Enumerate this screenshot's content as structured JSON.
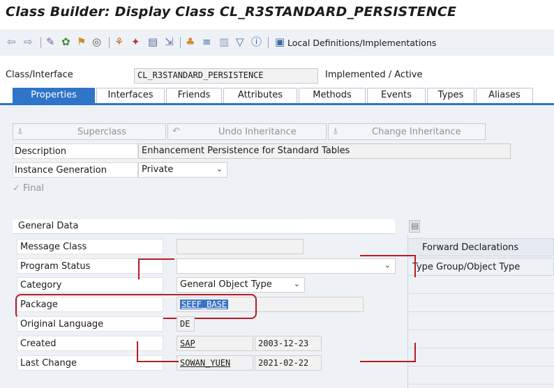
{
  "window": {
    "title": "Class Builder: Display Class CL_R3STANDARD_PERSISTENCE"
  },
  "toolbar": {
    "local_defs_label": "Local Definitions/Implementations"
  },
  "header": {
    "class_label": "Class/Interface",
    "class_value": "CL_R3STANDARD_PERSISTENCE",
    "status": "Implemented / Active"
  },
  "tabs": [
    "Properties",
    "Interfaces",
    "Friends",
    "Attributes",
    "Methods",
    "Events",
    "Types",
    "Aliases"
  ],
  "properties": {
    "superclass_btn": "Superclass",
    "undo_btn": "Undo Inheritance",
    "change_btn": "Change Inheritance",
    "description_label": "Description",
    "description_value": "Enhancement Persistence for Standard Tables",
    "instgen_label": "Instance Generation",
    "instgen_value": "Private",
    "final_label": "Final"
  },
  "general": {
    "title": "General Data",
    "message_class_label": "Message Class",
    "message_class_value": "",
    "program_status_label": "Program Status",
    "program_status_value": "",
    "category_label": "Category",
    "category_value": "General Object Type",
    "package_label": "Package",
    "package_value": "SEEF_BASE",
    "orig_lang_label": "Original Language",
    "orig_lang_value": "DE",
    "created_label": "Created",
    "created_user": "SAP",
    "created_date": "2003-12-23",
    "last_change_label": "Last Change",
    "last_change_user": "SOWAN_YUEN",
    "last_change_date": "2021-02-22"
  },
  "forward": {
    "title": "Forward Declarations",
    "col": "Type Group/Object Type"
  },
  "colors": {
    "accent": "#2e74c8",
    "highlight": "#b81c22"
  }
}
